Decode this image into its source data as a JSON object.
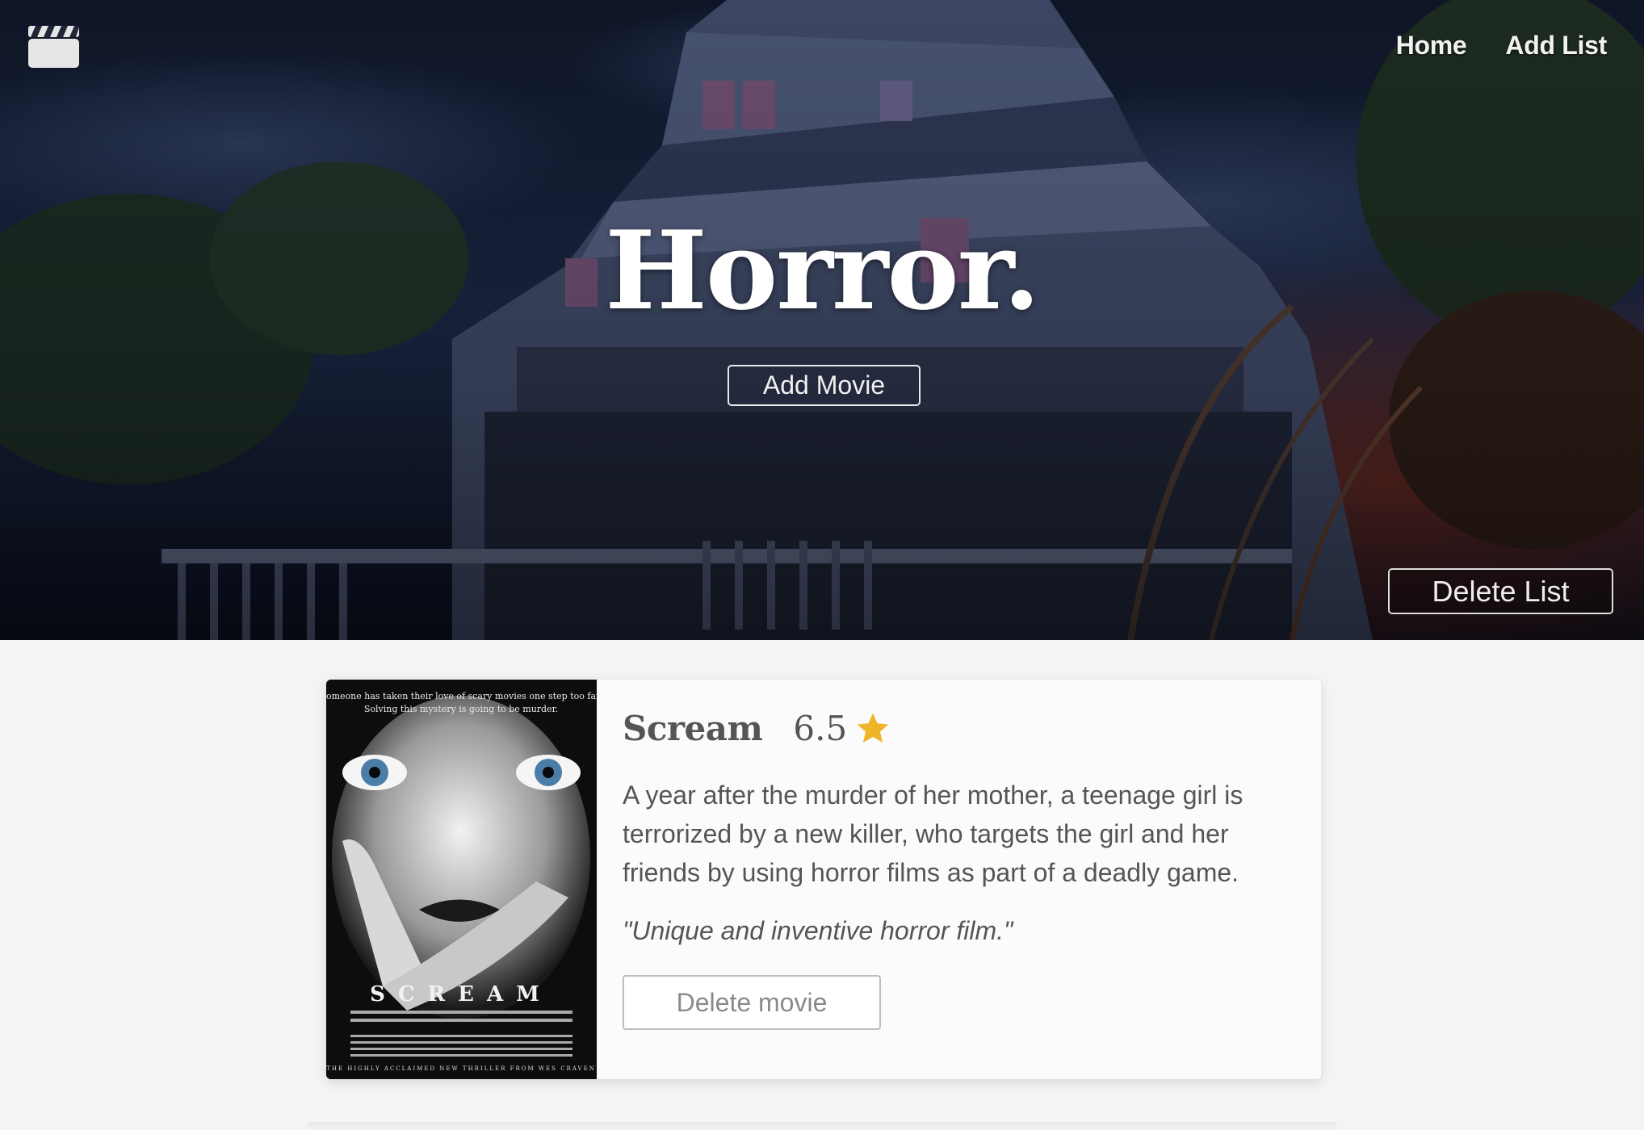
{
  "nav": {
    "home_label": "Home",
    "add_list_label": "Add List"
  },
  "hero": {
    "title": "Horror.",
    "add_movie_label": "Add Movie",
    "delete_list_label": "Delete List"
  },
  "movie": {
    "title": "Scream",
    "rating": "6.5",
    "description": "A year after the murder of her mother, a teenage girl is terrorized by a new killer, who targets the girl and her friends by using horror films as part of a deadly game.",
    "review": "\"Unique and inventive horror film.\"",
    "delete_label": "Delete movie",
    "poster": {
      "tagline_line1": "Someone has taken their love of scary movies one step too far.",
      "tagline_line2": "Solving this mystery is going to be murder.",
      "poster_title": "SCREAM",
      "bottom_line": "THE HIGHLY ACCLAIMED NEW THRILLER FROM WES CRAVEN"
    }
  },
  "colors": {
    "star": "#f0b429",
    "hero_sky": "#16203a",
    "card_bg": "#fbfbfb"
  },
  "icons": {
    "logo": "clapperboard-icon",
    "rating": "star-icon"
  }
}
